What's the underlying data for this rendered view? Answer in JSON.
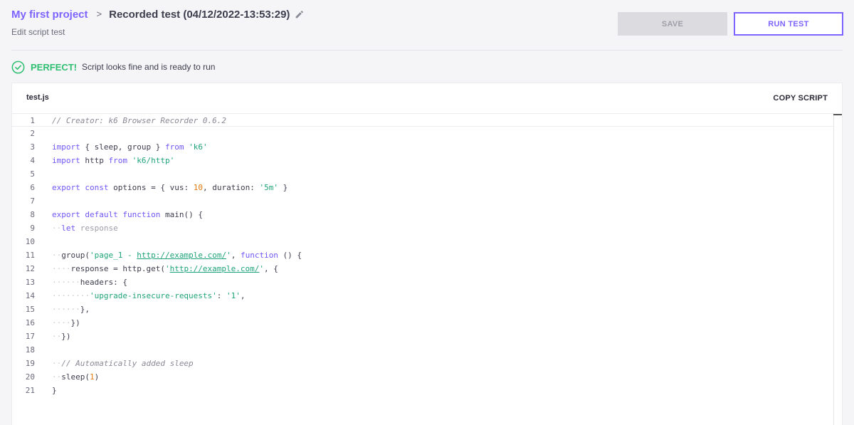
{
  "breadcrumb": {
    "project": "My first project",
    "separator": ">",
    "title": "Recorded test (04/12/2022-13:53:29)"
  },
  "subtitle": "Edit script test",
  "actions": {
    "save_label": "SAVE",
    "run_label": "RUN TEST"
  },
  "status": {
    "label": "PERFECT!",
    "message": "Script looks fine and is ready to run"
  },
  "editor": {
    "filename": "test.js",
    "copy_label": "COPY SCRIPT",
    "lines": [
      {
        "n": "1",
        "tokens": [
          [
            "cm",
            "// Creator: k6 Browser Recorder 0.6.2"
          ]
        ]
      },
      {
        "n": "2",
        "tokens": []
      },
      {
        "n": "3",
        "tokens": [
          [
            "kw",
            "import"
          ],
          [
            "",
            " { sleep, group } "
          ],
          [
            "kw",
            "from"
          ],
          [
            "",
            " "
          ],
          [
            "st",
            "'k6'"
          ]
        ]
      },
      {
        "n": "4",
        "tokens": [
          [
            "kw",
            "import"
          ],
          [
            "",
            " http "
          ],
          [
            "kw",
            "from"
          ],
          [
            "",
            " "
          ],
          [
            "st",
            "'k6/http'"
          ]
        ]
      },
      {
        "n": "5",
        "tokens": []
      },
      {
        "n": "6",
        "tokens": [
          [
            "kw",
            "export"
          ],
          [
            "",
            " "
          ],
          [
            "kw",
            "const"
          ],
          [
            "",
            " options = { vus: "
          ],
          [
            "nm",
            "10"
          ],
          [
            "",
            ", duration: "
          ],
          [
            "st",
            "'5m'"
          ],
          [
            "",
            " }"
          ]
        ]
      },
      {
        "n": "7",
        "tokens": []
      },
      {
        "n": "8",
        "tokens": [
          [
            "kw",
            "export"
          ],
          [
            "",
            " "
          ],
          [
            "kw",
            "default"
          ],
          [
            "",
            " "
          ],
          [
            "kw",
            "function"
          ],
          [
            "",
            " main() {"
          ]
        ]
      },
      {
        "n": "9",
        "tokens": [
          [
            "guide",
            "··"
          ],
          [
            "kw",
            "let"
          ],
          [
            "",
            " "
          ],
          [
            "dim",
            "response"
          ]
        ]
      },
      {
        "n": "10",
        "tokens": []
      },
      {
        "n": "11",
        "tokens": [
          [
            "guide",
            "··"
          ],
          [
            "",
            "group("
          ],
          [
            "st",
            "'page_1 - "
          ],
          [
            "lk",
            "http://example.com/"
          ],
          [
            "st",
            "'"
          ],
          [
            "",
            ", "
          ],
          [
            "kw",
            "function"
          ],
          [
            "",
            " () {"
          ]
        ]
      },
      {
        "n": "12",
        "tokens": [
          [
            "guide",
            "····"
          ],
          [
            "",
            "response = http.get("
          ],
          [
            "st",
            "'"
          ],
          [
            "lk",
            "http://example.com/"
          ],
          [
            "st",
            "'"
          ],
          [
            "",
            ", {"
          ]
        ]
      },
      {
        "n": "13",
        "tokens": [
          [
            "guide",
            "······"
          ],
          [
            "",
            "headers: {"
          ]
        ]
      },
      {
        "n": "14",
        "tokens": [
          [
            "guide",
            "········"
          ],
          [
            "st",
            "'upgrade-insecure-requests'"
          ],
          [
            "",
            ": "
          ],
          [
            "st",
            "'1'"
          ],
          [
            "",
            ","
          ]
        ]
      },
      {
        "n": "15",
        "tokens": [
          [
            "guide",
            "······"
          ],
          [
            "",
            "},"
          ]
        ]
      },
      {
        "n": "16",
        "tokens": [
          [
            "guide",
            "····"
          ],
          [
            "",
            "})"
          ]
        ]
      },
      {
        "n": "17",
        "tokens": [
          [
            "guide",
            "··"
          ],
          [
            "",
            "})"
          ]
        ]
      },
      {
        "n": "18",
        "tokens": []
      },
      {
        "n": "19",
        "tokens": [
          [
            "guide",
            "··"
          ],
          [
            "cm",
            "// Automatically added sleep"
          ]
        ]
      },
      {
        "n": "20",
        "tokens": [
          [
            "guide",
            "··"
          ],
          [
            "",
            "sleep("
          ],
          [
            "nm",
            "1"
          ],
          [
            "",
            ")"
          ]
        ]
      },
      {
        "n": "21",
        "tokens": [
          [
            "",
            "}"
          ]
        ]
      }
    ]
  },
  "icons": {
    "edit": "pencil-icon",
    "status": "check-circle-icon"
  },
  "colors": {
    "accent": "#7d64ff",
    "success": "#2fbf71",
    "keyword": "#6f57f5",
    "string": "#1fa37a",
    "number": "#e07b10",
    "comment": "#8a8a96"
  }
}
